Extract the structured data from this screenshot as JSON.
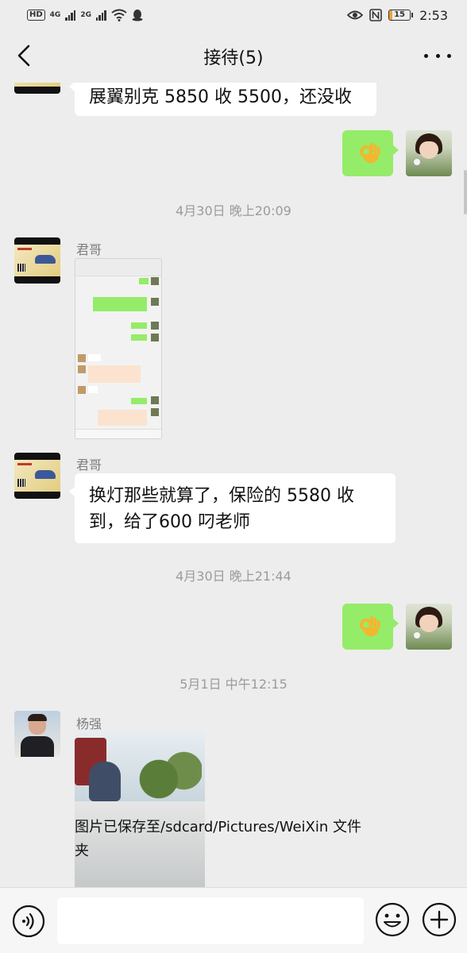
{
  "status_bar": {
    "left_badge": "HD",
    "net1": "4G",
    "net2": "2G",
    "battery": "15",
    "battery_level": 0.15,
    "time": "2:53"
  },
  "nav": {
    "title": "接待(5)",
    "back_icon": "chevron-left-icon",
    "more_icon": "more-dots-icon"
  },
  "messages": {
    "m1_text": "展翼别克 5850 收 5500，还没收",
    "ts1": "4月30日 晚上20:09",
    "m3_sender": "君哥",
    "m4_sender": "君哥",
    "m4_text_line1": "换灯那些就算了，保险的 5580 收",
    "m4_text_line2": "到，给了600 叼老师",
    "ts2": "4月30日 晚上21:44",
    "ts3": "5月1日 中午12:15",
    "m6_sender": "杨强",
    "m6_toast_line1": "图片已保存至/sdcard/Pictures/WeiXin 文件",
    "m6_toast_line2": "夹"
  },
  "input_bar": {
    "voice_icon": "voice-icon",
    "emoji_icon": "emoji-icon",
    "plus_icon": "plus-icon",
    "input_value": ""
  },
  "colors": {
    "background": "#ededed",
    "bubble_self": "#95ec69",
    "bubble_other": "#ffffff",
    "timestamp": "#9b9b9b"
  }
}
